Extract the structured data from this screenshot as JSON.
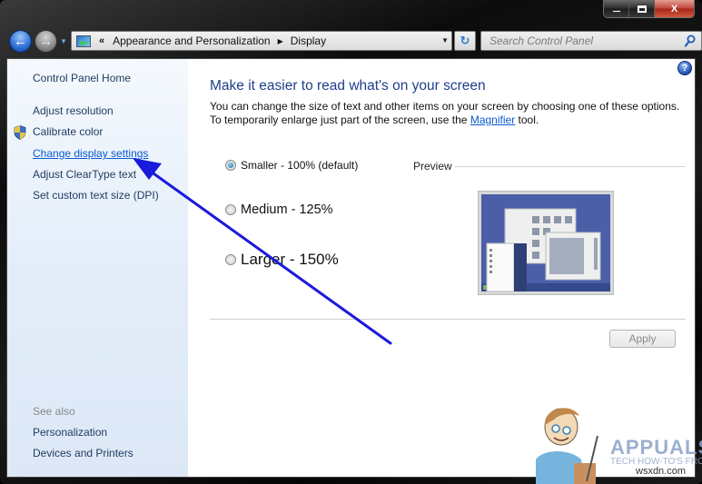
{
  "window": {
    "caption_buttons": {
      "minimize": "minimize",
      "maximize": "maximize",
      "close": "X"
    }
  },
  "nav": {
    "back_icon": "←",
    "forward_icon": "→",
    "history_icon": "▼",
    "address": {
      "overflow_chevron": "«",
      "crumbs": [
        "Appearance and Personalization",
        "Display"
      ],
      "separator": "▶",
      "dropdown_icon": "▼"
    },
    "refresh_icon": "↻",
    "search": {
      "placeholder": "Search Control Panel",
      "value": ""
    }
  },
  "sidebar": {
    "home": "Control Panel Home",
    "items": [
      {
        "label": "Adjust resolution",
        "link": false,
        "icon": null
      },
      {
        "label": "Calibrate color",
        "link": false,
        "icon": "shield-icon"
      },
      {
        "label": "Change display settings",
        "link": true,
        "icon": null
      },
      {
        "label": "Adjust ClearType text",
        "link": false,
        "icon": null
      },
      {
        "label": "Set custom text size (DPI)",
        "link": false,
        "icon": null
      }
    ],
    "see_also": {
      "heading": "See also",
      "items": [
        "Personalization",
        "Devices and Printers"
      ]
    }
  },
  "main": {
    "help_icon": "?",
    "title": "Make it easier to read what's on your screen",
    "description_line1": "You can change the size of text and other items on your screen by choosing one of these options.",
    "description_line2_pre": "To temporarily enlarge just part of the screen, use the ",
    "description_link": "Magnifier",
    "description_line2_post": " tool.",
    "options": [
      {
        "label": "Smaller - 100% (default)",
        "checked": true
      },
      {
        "label": "Medium - 125%",
        "checked": false
      },
      {
        "label": "Larger - 150%",
        "checked": false
      }
    ],
    "preview_label": "Preview",
    "apply_label": "Apply",
    "apply_enabled": false
  },
  "watermark": {
    "brand": "APPUALS",
    "tagline": "TECH HOW-TO'S FROM",
    "site": "wsxdn.com"
  },
  "colors": {
    "link": "#0b5ad2",
    "title": "#1e3f8a",
    "annotation_arrow": "#1a1adc",
    "sidebar_bg": "#e3edf9"
  }
}
